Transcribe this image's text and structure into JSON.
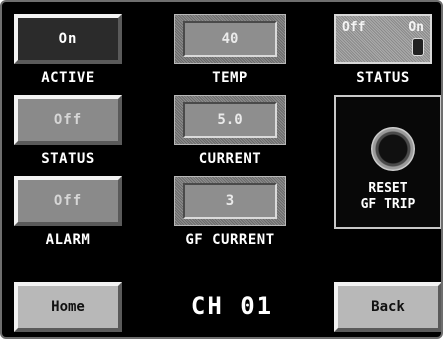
{
  "left_column": [
    {
      "value": "On",
      "label": "ACTIVE"
    },
    {
      "value": "Off",
      "label": "STATUS"
    },
    {
      "value": "Off",
      "label": "ALARM"
    }
  ],
  "center_column": [
    {
      "value": "40",
      "label": "TEMP"
    },
    {
      "value": "5.0",
      "label": "CURRENT"
    },
    {
      "value": "3",
      "label": "GF CURRENT"
    }
  ],
  "status_switch": {
    "off_label": "Off",
    "on_label": "On",
    "label": "STATUS"
  },
  "reset": {
    "line1": "RESET",
    "line2": "GF TRIP"
  },
  "nav": {
    "home": "Home",
    "back": "Back"
  },
  "channel": "CH 01"
}
